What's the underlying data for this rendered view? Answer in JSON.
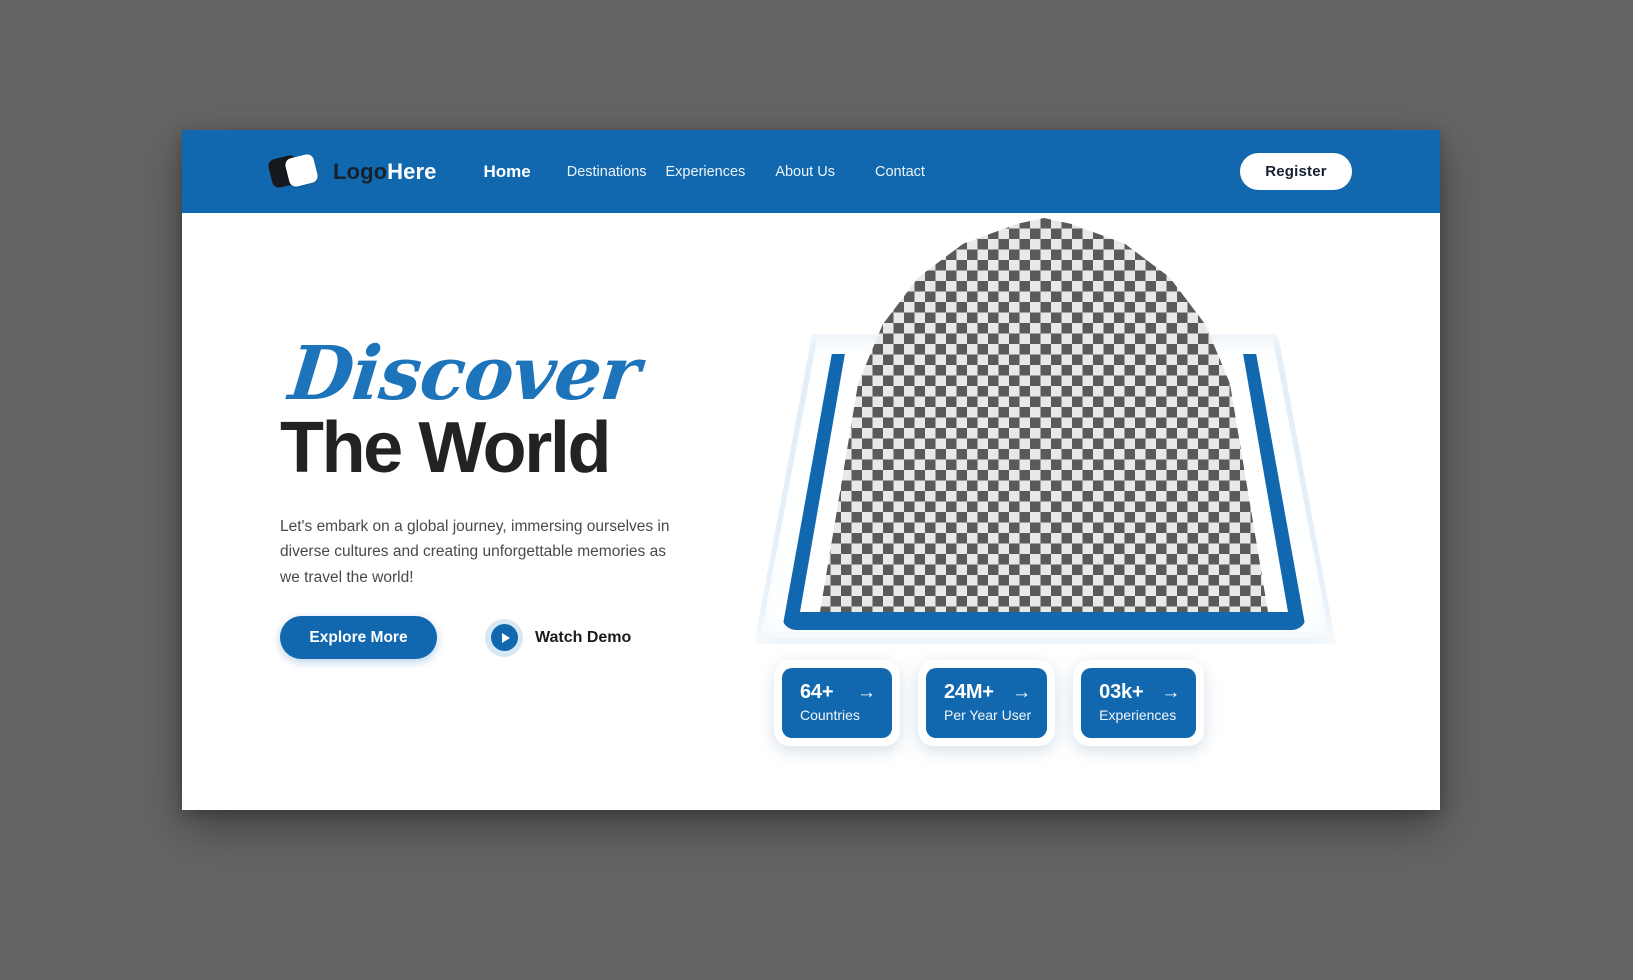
{
  "header": {
    "logo_icon": "two-overlapping-rounded-squares-icon",
    "brand_first": "Logo",
    "brand_second": "Here",
    "nav": [
      {
        "label": "Home",
        "active": true
      },
      {
        "label": "Destinations",
        "active": false
      },
      {
        "label": "Experiences",
        "active": false
      },
      {
        "label": "About Us",
        "active": false
      },
      {
        "label": "Contact",
        "active": false
      }
    ],
    "register_label": "Register"
  },
  "hero": {
    "headline_script": "Discover",
    "headline_main": "The World",
    "paragraph": "Let's embark on a global journey, immersing ourselves in diverse cultures and creating unforgettable memories as we travel the world!",
    "primary_cta": "Explore More",
    "secondary_cta": "Watch Demo",
    "play_icon": "play-triangle-icon",
    "image_placeholder": "transparent-checkerboard-placeholder"
  },
  "stats": [
    {
      "value": "64+",
      "label": "Countries",
      "arrow": "→"
    },
    {
      "value": "24M+",
      "label": "Per Year User",
      "arrow": "→"
    },
    {
      "value": "03k+",
      "label": "Experiences",
      "arrow": "→"
    }
  ],
  "colors": {
    "brand_blue": "#1168AE",
    "script_blue": "#1D74BB",
    "headline_dark": "#222222",
    "page_bg": "#FFFFFF",
    "canvas_bg": "#656565",
    "logo_dark": "#15181D"
  }
}
